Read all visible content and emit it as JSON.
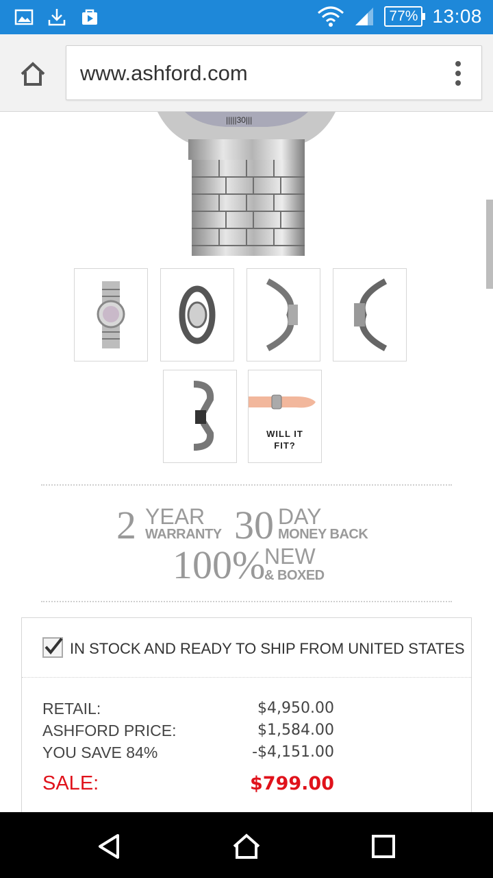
{
  "status_bar": {
    "icons_left": [
      "gallery-icon",
      "download-icon",
      "play-store-icon"
    ],
    "icons_right": [
      "wifi-icon",
      "cell-signal-icon"
    ],
    "battery": "77%",
    "time": "13:08"
  },
  "browser": {
    "url": "www.ashford.com",
    "home_icon": "home-icon",
    "menu_icon": "overflow-menu-icon"
  },
  "product": {
    "thumbnails": [
      {
        "name": "front-view"
      },
      {
        "name": "angled-view"
      },
      {
        "name": "side-view-right"
      },
      {
        "name": "side-view-left"
      },
      {
        "name": "clasp-view"
      },
      {
        "name": "will-it-fit",
        "label": "WILL IT FIT?"
      }
    ]
  },
  "guarantee": {
    "warranty_num": "2",
    "warranty_big": "YEAR",
    "warranty_small": "WARRANTY",
    "moneyback_num": "30",
    "moneyback_big": "DAY",
    "moneyback_small": "MONEY BACK",
    "new_num": "100%",
    "new_big": "NEW",
    "new_small": "& BOXED"
  },
  "stock": {
    "checked": true,
    "text": "IN STOCK AND READY TO SHIP  FROM UNITED STATES"
  },
  "pricing": {
    "retail_label": "RETAIL:",
    "retail_value": "$4,950.00",
    "ashford_label": "ASHFORD PRICE:",
    "ashford_value": "$1,584.00",
    "save_label": "YOU SAVE 84%",
    "save_value": "-$4,151.00",
    "sale_label": "SALE:",
    "sale_value": "$799.00",
    "sale_color": "#e0121b"
  },
  "nav_bar": {
    "back_icon": "back-triangle-icon",
    "home_icon": "home-circle-icon",
    "recents_icon": "recents-square-icon"
  }
}
